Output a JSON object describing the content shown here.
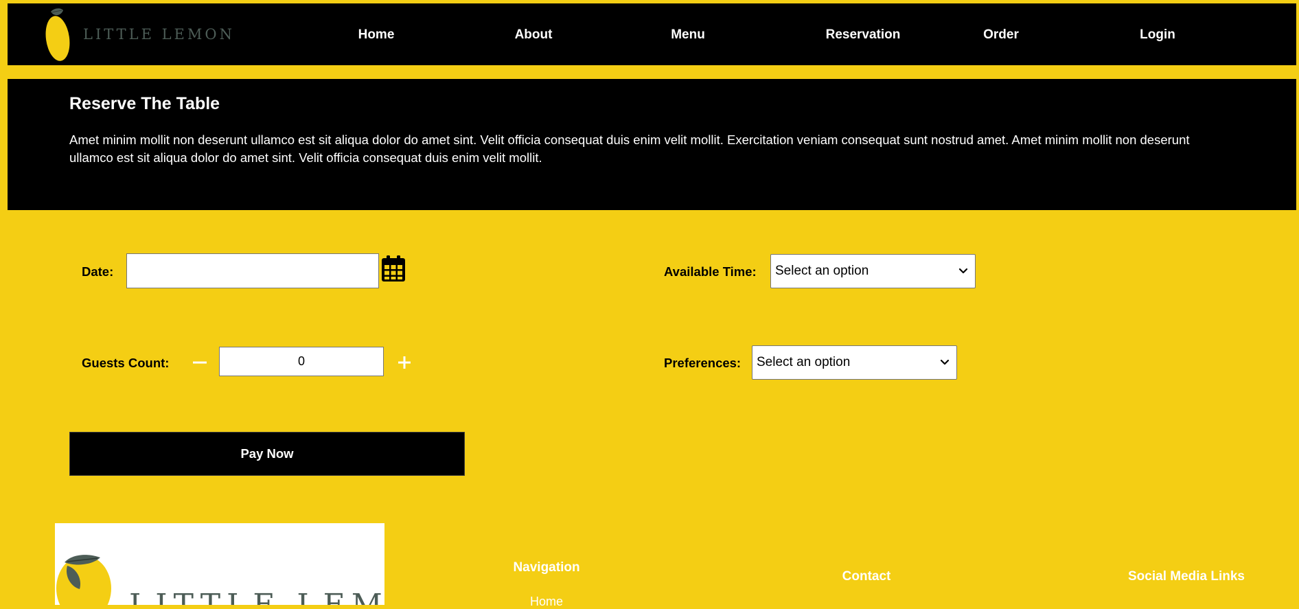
{
  "header": {
    "brand_text": "LITTLE LEMON",
    "nav": [
      {
        "label": "Home"
      },
      {
        "label": "About"
      },
      {
        "label": "Menu"
      },
      {
        "label": "Reservation"
      },
      {
        "label": "Order"
      },
      {
        "label": "Login"
      }
    ]
  },
  "hero": {
    "title": "Reserve The Table",
    "description": "Amet minim mollit non deserunt ullamco est sit aliqua dolor do amet sint. Velit officia consequat duis enim velit mollit. Exercitation veniam consequat sunt nostrud amet. Amet minim mollit non deserunt ullamco est sit aliqua dolor do amet sint. Velit officia consequat duis enim velit mollit."
  },
  "form": {
    "date_label": "Date:",
    "date_value": "",
    "time_label": "Available Time:",
    "time_selected": "Select an option",
    "guests_label": "Guests Count:",
    "guests_value": "0",
    "preferences_label": "Preferences:",
    "preferences_selected": "Select an option",
    "pay_label": "Pay Now"
  },
  "footer": {
    "logo_text": "LITTLE LEMON",
    "navigation_heading": "Navigation",
    "navigation_links": [
      "Home"
    ],
    "contact_heading": "Contact",
    "social_heading": "Social Media Links"
  },
  "icons": {
    "calendar": "calendar-icon",
    "minus": "minus-icon",
    "plus": "plus-icon",
    "chevron": "chevron-down-icon",
    "lemon": "lemon-logo-icon"
  },
  "colors": {
    "background": "#f4ce14",
    "dark": "#000000",
    "brand_green": "#4d5d57",
    "lemon": "#f4ce14"
  }
}
